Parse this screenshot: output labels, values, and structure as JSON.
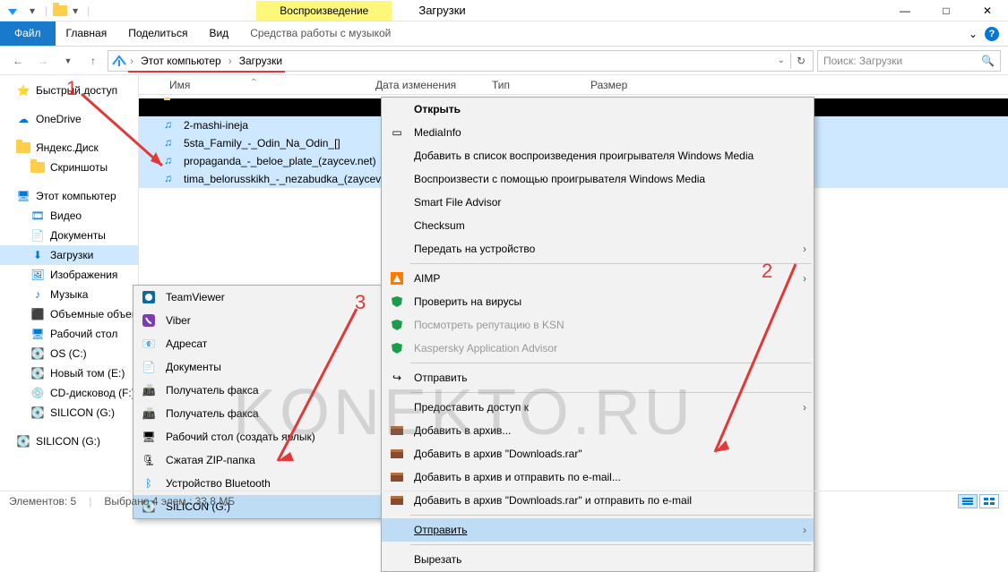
{
  "titlebar": {
    "context_label": "Воспроизведение",
    "window_title": "Загрузки",
    "minimize": "—",
    "maximize": "□",
    "close": "✕"
  },
  "ribbon": {
    "file": "Файл",
    "home": "Главная",
    "share": "Поделиться",
    "view": "Вид",
    "context": "Средства работы с музыкой",
    "caret": "⌄",
    "help": "?"
  },
  "addr": {
    "bc1": "Этот компьютер",
    "bc2": "Загрузки",
    "search_placeholder": "Поиск: Загрузки"
  },
  "columns": {
    "name": "Имя",
    "date": "Дата изменения",
    "type": "Тип",
    "size": "Размер"
  },
  "nav": {
    "quick": "Быстрый доступ",
    "onedrive": "OneDrive",
    "yandex": "Яндекс.Диск",
    "screenshots": "Скриншоты",
    "thispc": "Этот компьютер",
    "videos": "Видео",
    "documents": "Документы",
    "downloads": "Загрузки",
    "images": "Изображения",
    "music": "Музыка",
    "objects3d": "Объемные объекты",
    "desktop": "Рабочий стол",
    "os": "OS (C:)",
    "newvol": "Новый том (E:)",
    "cdrom": "CD-дисковод (F:)",
    "silicon": "SILICON (G:)",
    "silicon2": "SILICON (G:)"
  },
  "files": {
    "f1": "2-mashi-ineja",
    "f2": "5sta_Family_-_Odin_Na_Odin_[]",
    "f3": "propaganda_-_beloe_plate_(zaycev.net)",
    "f4": "tima_belorusskikh_-_nezabudka_(zaycev..."
  },
  "ctx": {
    "open": "Открыть",
    "mediainfo": "MediaInfo",
    "wmp_add": "Добавить в список воспроизведения проигрывателя Windows Media",
    "wmp_play": "Воспроизвести с помощью проигрывателя Windows Media",
    "sfa": "Smart File Advisor",
    "checksum": "Checksum",
    "cast": "Передать на устройство",
    "aimp": "AIMP",
    "av_check": "Проверить на вирусы",
    "ksn": "Посмотреть репутацию в KSN",
    "kaa": "Kaspersky Application Advisor",
    "send": "Отправить",
    "grant": "Предоставить доступ к",
    "rar_add": "Добавить в архив...",
    "rar_dl": "Добавить в архив \"Downloads.rar\"",
    "rar_email": "Добавить в архив и отправить по e-mail...",
    "rar_dl_email": "Добавить в архив \"Downloads.rar\" и отправить по e-mail",
    "sendto": "Отправить",
    "cut": "Вырезать"
  },
  "sendto": {
    "teamviewer": "TeamViewer",
    "viber": "Viber",
    "adressat": "Адресат",
    "documents": "Документы",
    "fax1": "Получатель факса",
    "fax2": "Получатель факса",
    "desktop": "Рабочий стол (создать ярлык)",
    "zip": "Сжатая ZIP-папка",
    "bt": "Устройство Bluetooth",
    "silicon": "SILICON (G:)"
  },
  "status": {
    "elements": "Элементов: 5",
    "selected": "Выбрано 4 элем.: 33,8 МБ"
  },
  "anno": {
    "n1": "1",
    "n2": "2",
    "n3": "3"
  },
  "watermark": "KONEKTO.RU"
}
